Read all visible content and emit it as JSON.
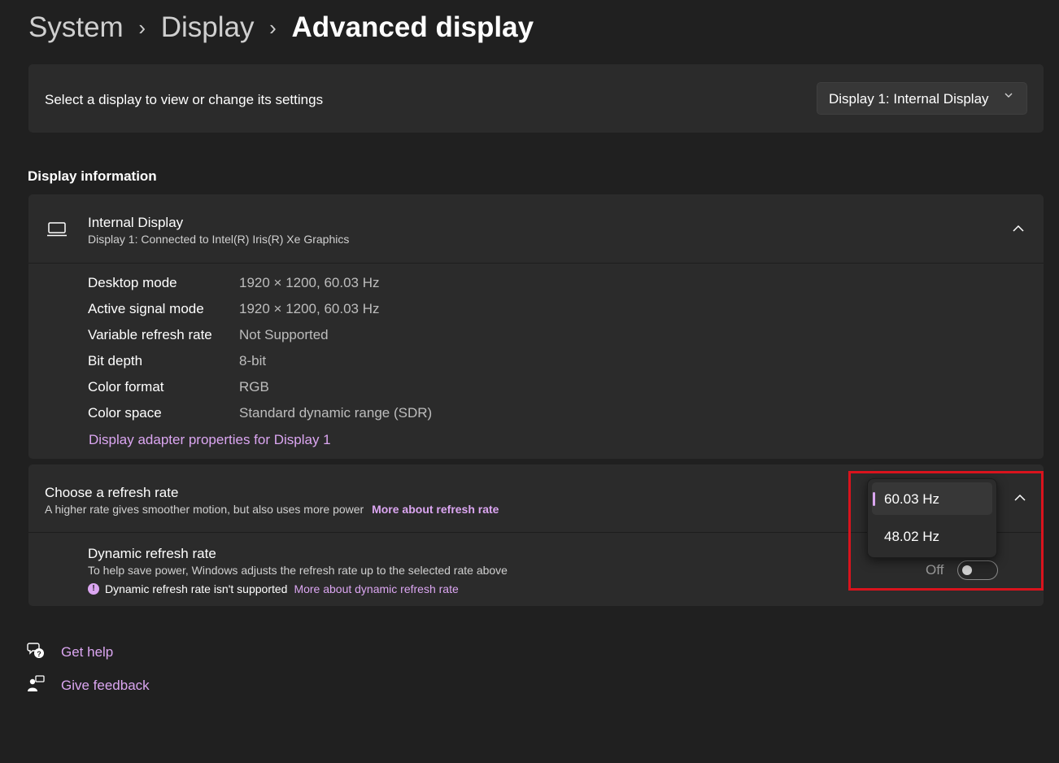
{
  "breadcrumb": {
    "items": [
      "System",
      "Display",
      "Advanced display"
    ],
    "separator": "›"
  },
  "display_select": {
    "label": "Select a display to view or change its settings",
    "selected": "Display 1: Internal Display"
  },
  "display_information": {
    "section_title": "Display information",
    "display_name": "Internal Display",
    "display_subtitle": "Display 1: Connected to Intel(R) Iris(R) Xe Graphics",
    "rows": [
      {
        "key": "Desktop mode",
        "value": "1920 × 1200, 60.03 Hz"
      },
      {
        "key": "Active signal mode",
        "value": "1920 × 1200, 60.03 Hz"
      },
      {
        "key": "Variable refresh rate",
        "value": "Not Supported"
      },
      {
        "key": "Bit depth",
        "value": "8-bit"
      },
      {
        "key": "Color format",
        "value": "RGB"
      },
      {
        "key": "Color space",
        "value": "Standard dynamic range (SDR)"
      }
    ],
    "adapter_link": "Display adapter properties for Display 1"
  },
  "refresh_rate": {
    "title": "Choose a refresh rate",
    "subtitle": "A higher rate gives smoother motion, but also uses more power",
    "more_link": "More about refresh rate",
    "options": [
      "60.03 Hz",
      "48.02 Hz"
    ],
    "selected_index": 0
  },
  "dynamic_refresh": {
    "title": "Dynamic refresh rate",
    "subtitle": "To help save power, Windows adjusts the refresh rate up to the selected rate above",
    "note": "Dynamic refresh rate isn't supported",
    "more_link": "More about dynamic refresh rate",
    "toggle_label": "Off",
    "toggle_on": false
  },
  "footer": {
    "get_help": "Get help",
    "give_feedback": "Give feedback"
  },
  "colors": {
    "background": "#202020",
    "card": "#2b2b2b",
    "accent": "#dba6f1",
    "highlight": "#d9131d"
  }
}
